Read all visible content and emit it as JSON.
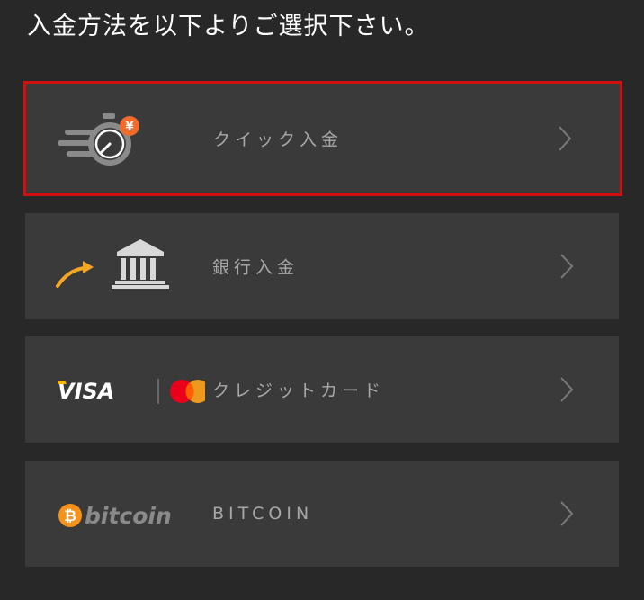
{
  "heading": "入金方法を以下よりご選択下さい。",
  "options": [
    {
      "label": "クイック入金",
      "icon": "stopwatch-yen-icon",
      "selected": true
    },
    {
      "label": "銀行入金",
      "icon": "bank-icon",
      "selected": false
    },
    {
      "label": "クレジットカード",
      "icon": "visa-mastercard-icon",
      "selected": false
    },
    {
      "label": "BITCOIN",
      "icon": "bitcoin-logo-icon",
      "selected": false
    }
  ],
  "logos": {
    "visa": "VISA",
    "bitcoin": "bitcoin",
    "yen": "¥"
  },
  "colors": {
    "background": "#282828",
    "card": "#3a3a3a",
    "selection_border": "#d10f0f",
    "label": "#a8a8a8",
    "accent_orange": "#f26b2c",
    "bitcoin_orange": "#f7931a",
    "arrow_yellow": "#f5a623"
  }
}
